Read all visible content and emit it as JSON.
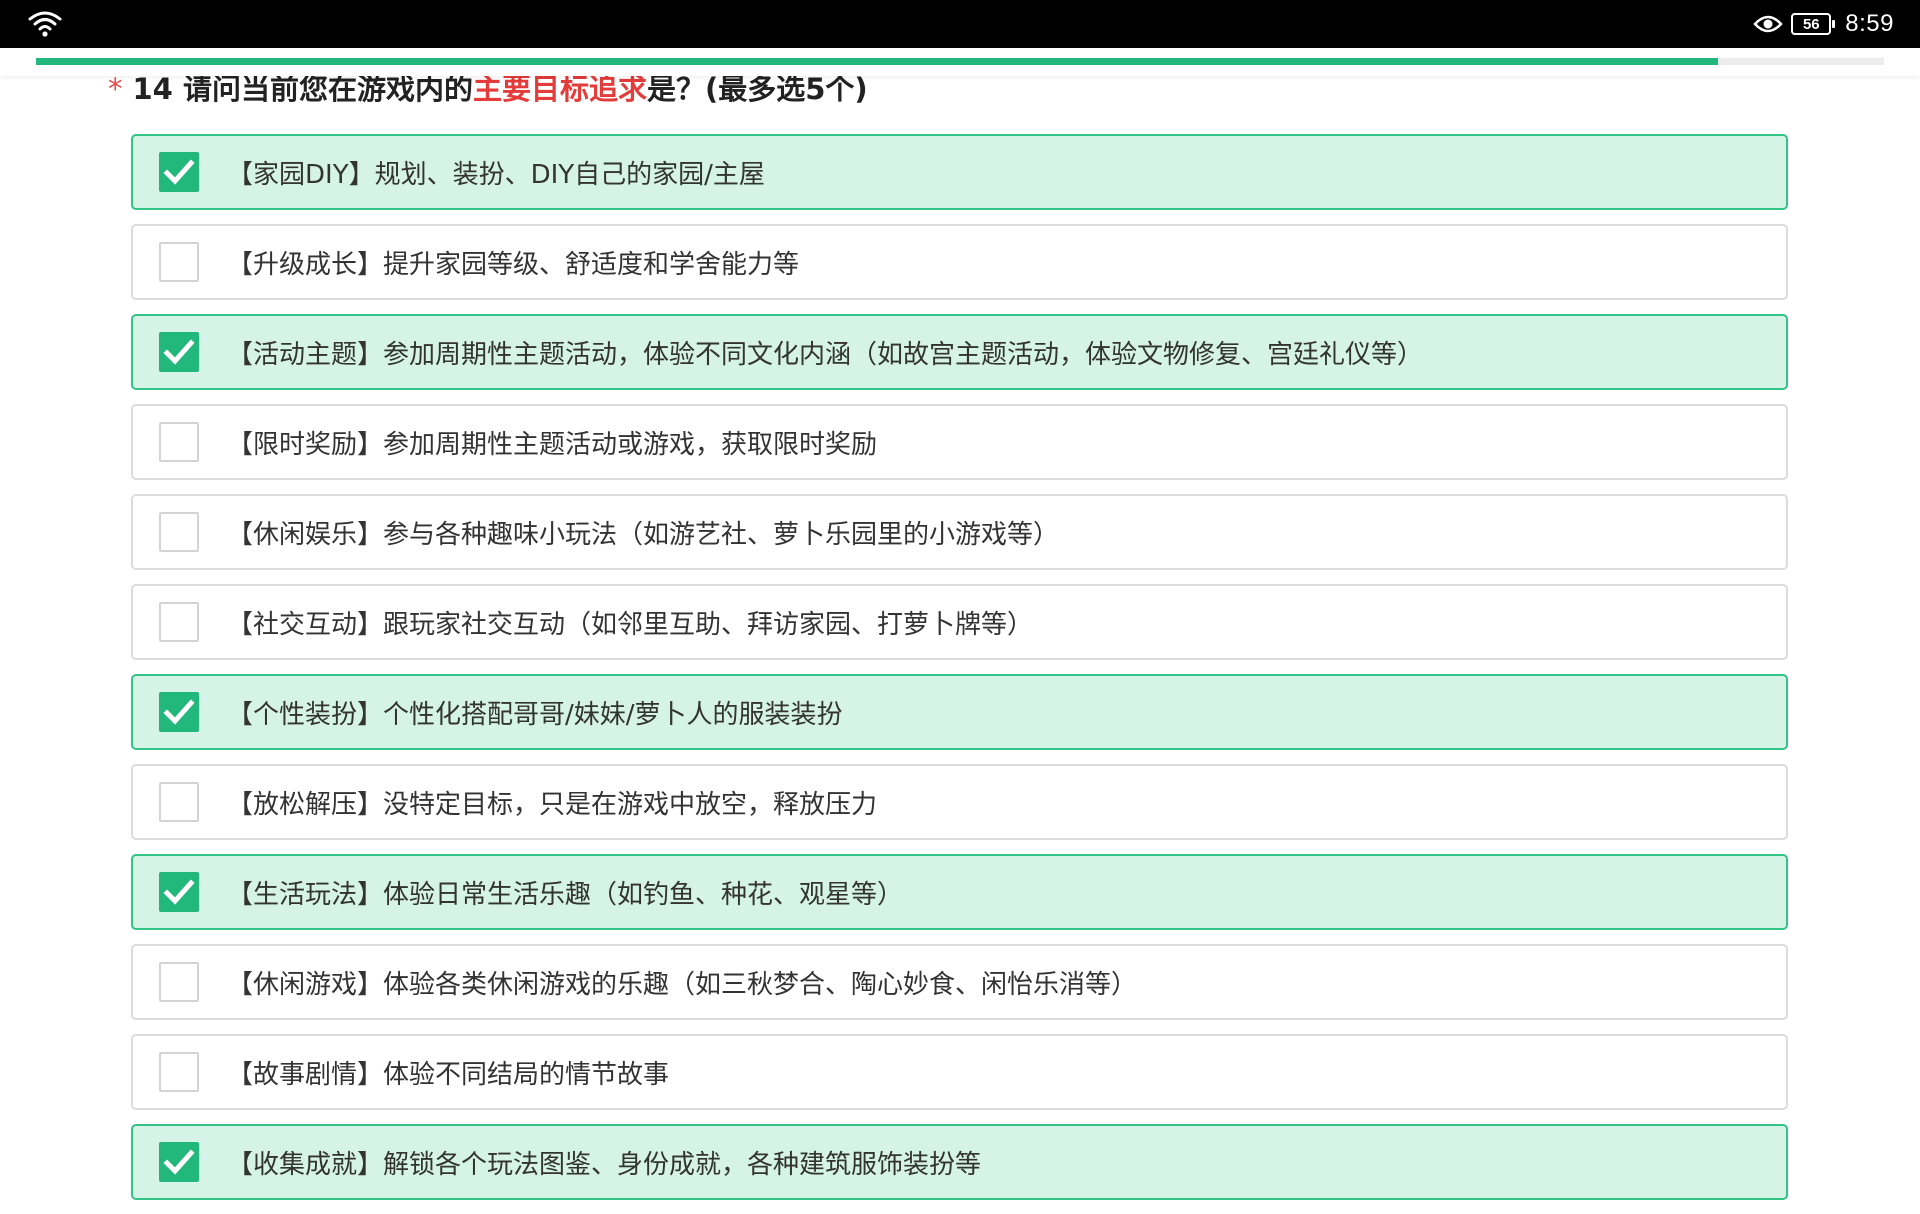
{
  "status_bar": {
    "wifi_icon": "wifi-icon",
    "eye_icon": "eye-comfort-icon",
    "battery_level": "56",
    "time": "8:59"
  },
  "progress": {
    "value": 0.91,
    "color": "#22b77b"
  },
  "question": {
    "required_mark": "*",
    "title_prefix": "14 请问当前您在游戏内的",
    "title_highlight": "主要目标追求",
    "title_suffix": "是？(最多选5个)",
    "highlight_color": "#e43b3b"
  },
  "options": [
    {
      "label": "【家园DIY】规划、装扮、DIY自己的家园/主屋",
      "checked": true
    },
    {
      "label": "【升级成长】提升家园等级、舒适度和学舍能力等",
      "checked": false
    },
    {
      "label": "【活动主题】参加周期性主题活动，体验不同文化内涵（如故宫主题活动，体验文物修复、宫廷礼仪等）",
      "checked": true
    },
    {
      "label": "【限时奖励】参加周期性主题活动或游戏，获取限时奖励",
      "checked": false
    },
    {
      "label": "【休闲娱乐】参与各种趣味小玩法（如游艺社、萝卜乐园里的小游戏等）",
      "checked": false
    },
    {
      "label": "【社交互动】跟玩家社交互动（如邻里互助、拜访家园、打萝卜牌等）",
      "checked": false
    },
    {
      "label": "【个性装扮】个性化搭配哥哥/妹妹/萝卜人的服装装扮",
      "checked": true
    },
    {
      "label": "【放松解压】没特定目标，只是在游戏中放空，释放压力",
      "checked": false
    },
    {
      "label": "【生活玩法】体验日常生活乐趣（如钓鱼、种花、观星等）",
      "checked": true
    },
    {
      "label": "【休闲游戏】体验各类休闲游戏的乐趣（如三秋梦合、陶心妙食、闲怡乐消等）",
      "checked": false
    },
    {
      "label": "【故事剧情】体验不同结局的情节故事",
      "checked": false
    },
    {
      "label": "【收集成就】解锁各个玩法图鉴、身份成就，各种建筑服饰装扮等",
      "checked": true
    }
  ],
  "colors": {
    "checked_background": "#d5f3e7",
    "checked_border": "#34c386",
    "checkbox_checked": "#22b77b",
    "unchecked_border": "#dcdcdc"
  }
}
